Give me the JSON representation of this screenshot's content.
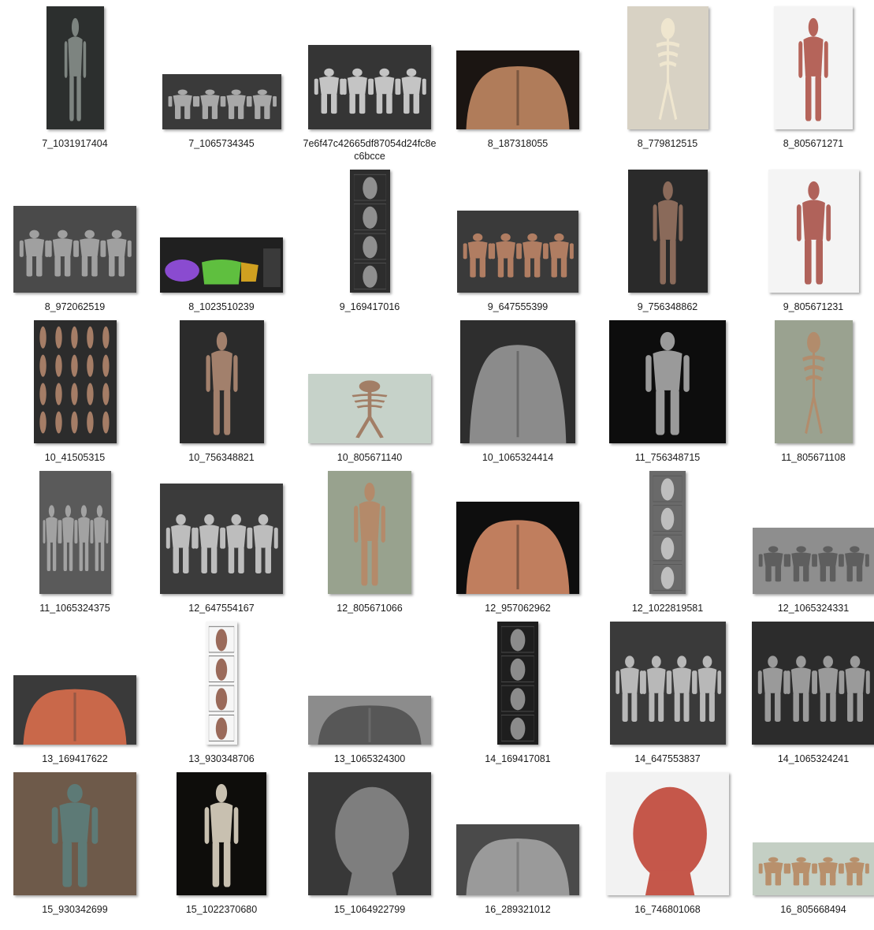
{
  "files": [
    {
      "name": "7_1031917404",
      "bg": "#2c2f2e",
      "fg": "#7d8480",
      "kind": "figure"
    },
    {
      "name": "7_1065734345",
      "bg": "#3a3a3a",
      "fg": "#a8a8a8",
      "kind": "multi"
    },
    {
      "name": "7e6f47c42665df87054d24fc8ec6bcce",
      "bg": "#353535",
      "fg": "#c4c4c4",
      "kind": "multi"
    },
    {
      "name": "8_187318055",
      "bg": "#1b1512",
      "fg": "#b07c5a",
      "kind": "torso"
    },
    {
      "name": "8_779812515",
      "bg": "#d8d2c4",
      "fg": "#efe6cf",
      "kind": "skeleton"
    },
    {
      "name": "8_805671271",
      "bg": "#f4f4f4",
      "fg": "#b5645a",
      "kind": "figure"
    },
    {
      "name": "8_972062519",
      "bg": "#4a4a4a",
      "fg": "#a0a0a0",
      "kind": "multi"
    },
    {
      "name": "8_1023510239",
      "bg": "#202020",
      "fg": "#8a4bd0",
      "kind": "chart"
    },
    {
      "name": "9_169417016",
      "bg": "#2d2d2d",
      "fg": "#8f8f8f",
      "kind": "stack"
    },
    {
      "name": "9_647555399",
      "bg": "#3a3a3a",
      "fg": "#b07d62",
      "kind": "multi"
    },
    {
      "name": "9_756348862",
      "bg": "#2a2a2a",
      "fg": "#8a6a5a",
      "kind": "figure"
    },
    {
      "name": "9_805671231",
      "bg": "#f4f4f4",
      "fg": "#b0625a",
      "kind": "figure"
    },
    {
      "name": "10_41505315",
      "bg": "#2c2c2c",
      "fg": "#a57d66",
      "kind": "grid"
    },
    {
      "name": "10_756348821",
      "bg": "#2b2b2b",
      "fg": "#a2806c",
      "kind": "figure"
    },
    {
      "name": "10_805671140",
      "bg": "#c6d2c9",
      "fg": "#a27e66",
      "kind": "skeleton"
    },
    {
      "name": "10_1065324414",
      "bg": "#2e2e2e",
      "fg": "#8b8b8b",
      "kind": "torso"
    },
    {
      "name": "11_756348715",
      "bg": "#0d0d0d",
      "fg": "#9a9a9a",
      "kind": "figure"
    },
    {
      "name": "11_805671108",
      "bg": "#9aa290",
      "fg": "#b28c6c",
      "kind": "skeleton"
    },
    {
      "name": "11_1065324375",
      "bg": "#5a5a5a",
      "fg": "#a2a2a2",
      "kind": "multi"
    },
    {
      "name": "12_647554167",
      "bg": "#3b3b3b",
      "fg": "#bdbdbd",
      "kind": "multi"
    },
    {
      "name": "12_805671066",
      "bg": "#98a28e",
      "fg": "#b48a6a",
      "kind": "figure"
    },
    {
      "name": "12_957062962",
      "bg": "#0e0e0e",
      "fg": "#c07e5e",
      "kind": "torso"
    },
    {
      "name": "12_1022819581",
      "bg": "#6a6a6a",
      "fg": "#bebebe",
      "kind": "stack"
    },
    {
      "name": "12_1065324331",
      "bg": "#8e8e8e",
      "fg": "#5e5e5e",
      "kind": "multi"
    },
    {
      "name": "13_169417622",
      "bg": "#3a3a3a",
      "fg": "#c9684a",
      "kind": "torso"
    },
    {
      "name": "13_930348706",
      "bg": "#f6f6f6",
      "fg": "#9a6a5a",
      "kind": "stack"
    },
    {
      "name": "13_1065324300",
      "bg": "#8c8c8c",
      "fg": "#575757",
      "kind": "torso"
    },
    {
      "name": "14_169417081",
      "bg": "#1e1e1e",
      "fg": "#8b8b8b",
      "kind": "stack"
    },
    {
      "name": "14_647553837",
      "bg": "#3a3a3a",
      "fg": "#b8b8b8",
      "kind": "multi"
    },
    {
      "name": "14_1065324241",
      "bg": "#2c2c2c",
      "fg": "#9a9a9a",
      "kind": "multi"
    },
    {
      "name": "15_930342699",
      "bg": "#6e5a4a",
      "fg": "#5d7a76",
      "kind": "figure"
    },
    {
      "name": "15_1022370680",
      "bg": "#0e0d0b",
      "fg": "#c8c0b0",
      "kind": "figure"
    },
    {
      "name": "15_1064922799",
      "bg": "#383838",
      "fg": "#7e7e7e",
      "kind": "head"
    },
    {
      "name": "16_289321012",
      "bg": "#4a4a4a",
      "fg": "#9a9a9a",
      "kind": "torso"
    },
    {
      "name": "16_746801068",
      "bg": "#f2f2f2",
      "fg": "#c5574a",
      "kind": "head"
    },
    {
      "name": "16_805668494",
      "bg": "#c4cfc4",
      "fg": "#b8906c",
      "kind": "multi"
    }
  ]
}
